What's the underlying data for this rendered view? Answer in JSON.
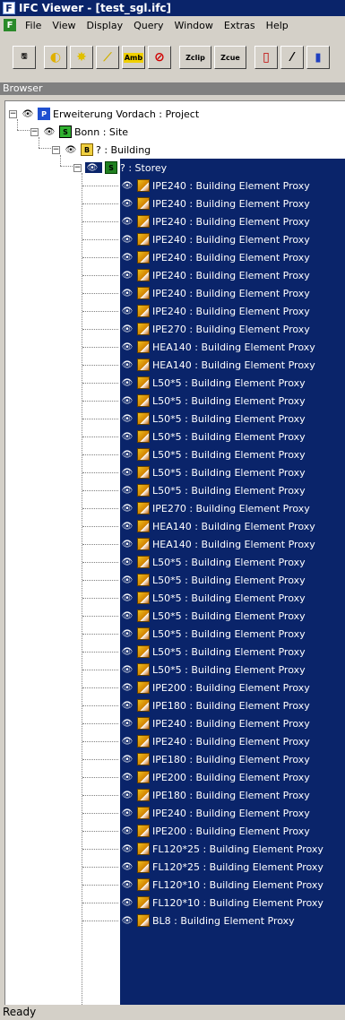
{
  "window": {
    "title": "IFC Viewer - [test_sgl.ifc]"
  },
  "menu": [
    "File",
    "View",
    "Display",
    "Query",
    "Window",
    "Extras",
    "Help"
  ],
  "toolbar": {
    "buttons": [
      {
        "name": "open-icon",
        "label": ""
      },
      {
        "name": "light-icon",
        "label": ""
      },
      {
        "name": "sun-icon",
        "label": ""
      },
      {
        "name": "ray-icon",
        "label": ""
      },
      {
        "name": "amb-icon",
        "label": "Amb"
      },
      {
        "name": "no-icon",
        "label": ""
      },
      {
        "name": "zclip-icon",
        "label": "Zclip"
      },
      {
        "name": "zcue-icon",
        "label": "Zcue"
      },
      {
        "name": "cylinder-icon",
        "label": ""
      },
      {
        "name": "measure-icon",
        "label": ""
      },
      {
        "name": "book-icon",
        "label": ""
      }
    ]
  },
  "browser": {
    "title": "Browser",
    "project": "Erweiterung Vordach : Project",
    "site": "Bonn : Site",
    "building": "? : Building",
    "storey": "? : Storey",
    "elements": [
      "IPE240 : Building Element Proxy",
      "IPE240 : Building Element Proxy",
      "IPE240 : Building Element Proxy",
      "IPE240 : Building Element Proxy",
      "IPE240 : Building Element Proxy",
      "IPE240 : Building Element Proxy",
      "IPE240 : Building Element Proxy",
      "IPE240 : Building Element Proxy",
      "IPE270 : Building Element Proxy",
      "HEA140 : Building Element Proxy",
      "HEA140 : Building Element Proxy",
      "L50*5 : Building Element Proxy",
      "L50*5 : Building Element Proxy",
      "L50*5 : Building Element Proxy",
      "L50*5 : Building Element Proxy",
      "L50*5 : Building Element Proxy",
      "L50*5 : Building Element Proxy",
      "L50*5 : Building Element Proxy",
      "IPE270 : Building Element Proxy",
      "HEA140 : Building Element Proxy",
      "HEA140 : Building Element Proxy",
      "L50*5 : Building Element Proxy",
      "L50*5 : Building Element Proxy",
      "L50*5 : Building Element Proxy",
      "L50*5 : Building Element Proxy",
      "L50*5 : Building Element Proxy",
      "L50*5 : Building Element Proxy",
      "L50*5 : Building Element Proxy",
      "IPE200 : Building Element Proxy",
      "IPE180 : Building Element Proxy",
      "IPE240 : Building Element Proxy",
      "IPE240 : Building Element Proxy",
      "IPE180 : Building Element Proxy",
      "IPE200 : Building Element Proxy",
      "IPE180 : Building Element Proxy",
      "IPE240 : Building Element Proxy",
      "IPE200 : Building Element Proxy",
      "FL120*25 : Building Element Proxy",
      "FL120*25 : Building Element Proxy",
      "FL120*10 : Building Element Proxy",
      "FL120*10 : Building Element Proxy",
      "BL8 : Building Element Proxy"
    ]
  },
  "status": {
    "text": "Ready"
  },
  "colors": {
    "selection": "#0a246a",
    "face": "#d4d0c8"
  }
}
